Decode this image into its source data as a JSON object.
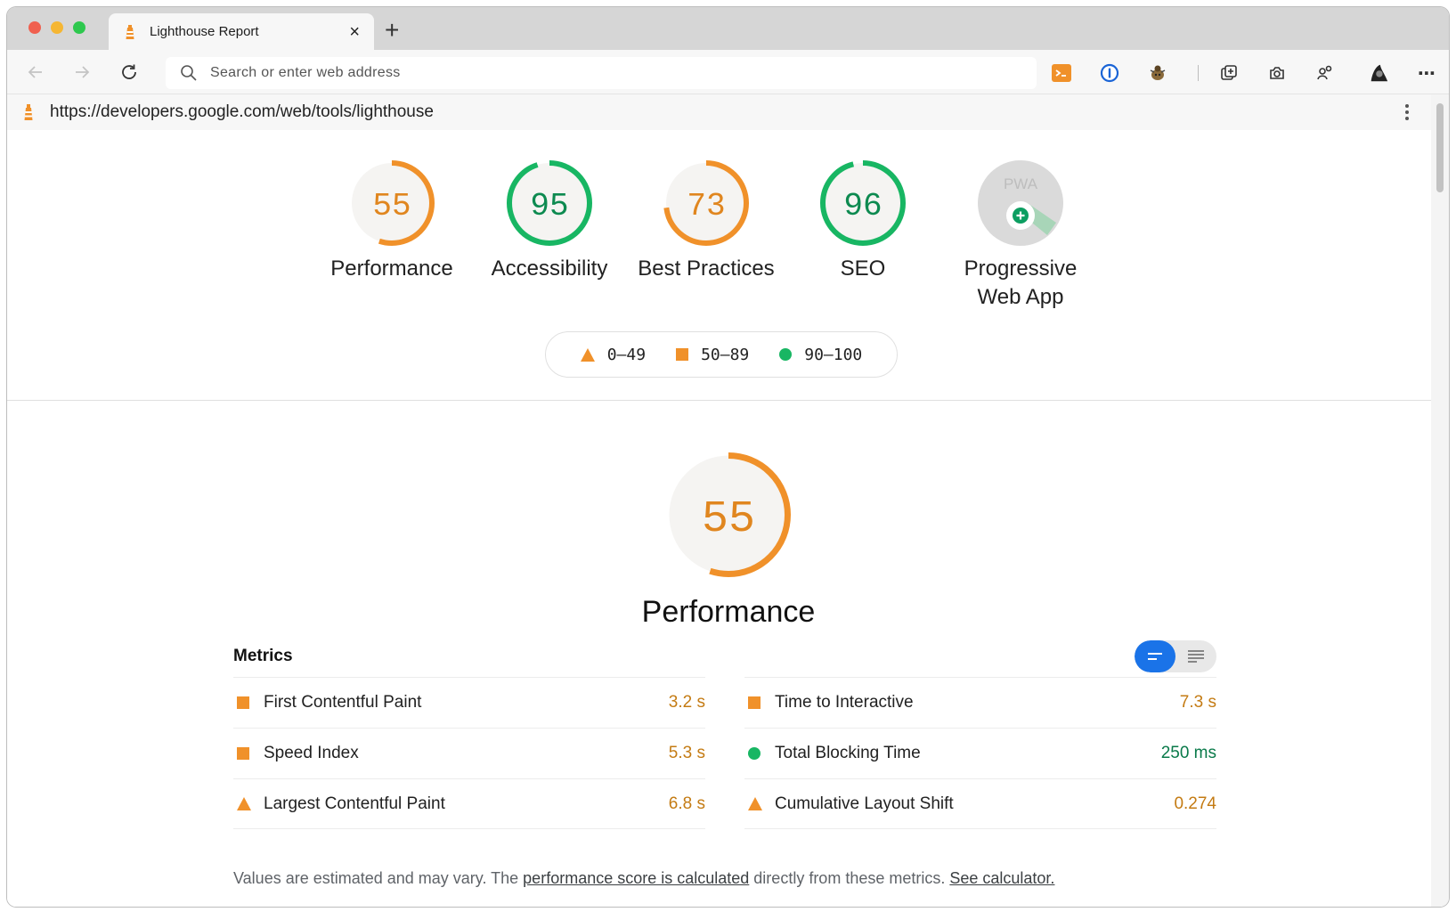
{
  "browser": {
    "tab_title": "Lighthouse Report",
    "tab_close": "×",
    "new_tab": "+",
    "address_placeholder": "Search or enter web address",
    "app_url": "https://developers.google.com/web/tools/lighthouse",
    "menu": "⋯",
    "url_menu": "⋮"
  },
  "colors": {
    "fail": "#f0912a",
    "average": "#f0912a",
    "pass": "#18b663",
    "gauge_bg": "#f5f4f2",
    "accent": "#1a73e8"
  },
  "scores": [
    {
      "label": "Performance",
      "score": 55,
      "rating": "average"
    },
    {
      "label": "Accessibility",
      "score": 95,
      "rating": "pass"
    },
    {
      "label": "Best Practices",
      "score": 73,
      "rating": "average"
    },
    {
      "label": "SEO",
      "score": 96,
      "rating": "pass"
    },
    {
      "label": "Progressive Web App",
      "score": null,
      "badge": "PWA",
      "rating": "pwa"
    }
  ],
  "legend": {
    "fail": "0–49",
    "average": "50–89",
    "pass": "90–100"
  },
  "performance": {
    "title": "Performance",
    "score": 55,
    "metrics_title": "Metrics",
    "metrics_left": [
      {
        "name": "First Contentful Paint",
        "value": "3.2 s",
        "rating": "average"
      },
      {
        "name": "Speed Index",
        "value": "5.3 s",
        "rating": "average"
      },
      {
        "name": "Largest Contentful Paint",
        "value": "6.8 s",
        "rating": "fail"
      }
    ],
    "metrics_right": [
      {
        "name": "Time to Interactive",
        "value": "7.3 s",
        "rating": "average"
      },
      {
        "name": "Total Blocking Time",
        "value": "250 ms",
        "rating": "pass"
      },
      {
        "name": "Cumulative Layout Shift",
        "value": "0.274",
        "rating": "fail"
      }
    ],
    "footnote": {
      "before": "Values are estimated and may vary. The ",
      "link1": "performance score is calculated",
      "middle": " directly from these metrics. ",
      "link2": "See calculator."
    }
  }
}
